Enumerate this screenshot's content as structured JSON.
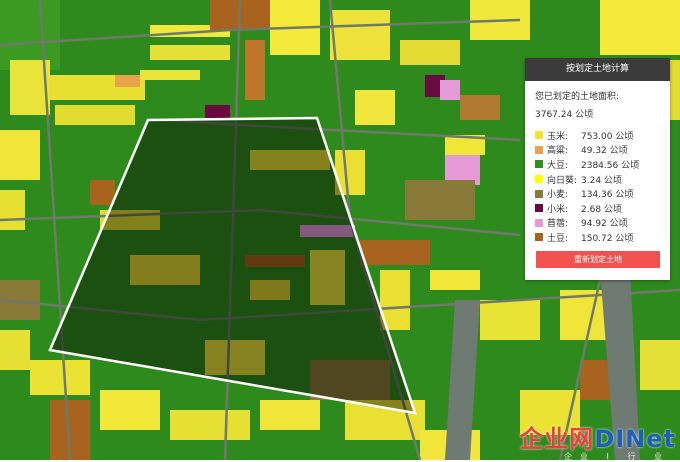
{
  "panel": {
    "title": "按划定土地计算",
    "area_label": "您已划定的土地面积:",
    "total": "3767.24 公顷",
    "button": "重新划定土地"
  },
  "crops": [
    {
      "name": "玉米:",
      "value": "753.00 公顷",
      "color": "#f2e42b"
    },
    {
      "name": "高粱:",
      "value": "49.32 公顷",
      "color": "#e9a24a"
    },
    {
      "name": "大豆:",
      "value": "2384.56 公顷",
      "color": "#2f8f1f"
    },
    {
      "name": "向日葵:",
      "value": "3.24 公顷",
      "color": "#ffff00"
    },
    {
      "name": "小麦:",
      "value": "134.36 公顷",
      "color": "#8a7a3a"
    },
    {
      "name": "小米:",
      "value": "2.68 公顷",
      "color": "#6a0a40"
    },
    {
      "name": "苜蓿:",
      "value": "94.92 公顷",
      "color": "#e59ad8"
    },
    {
      "name": "土豆:",
      "value": "150.72 公顷",
      "color": "#a8641e"
    }
  ],
  "watermark": {
    "a": "企业网",
    "b": "D",
    "c": "INet",
    "sub": "企业 I 行 业"
  }
}
